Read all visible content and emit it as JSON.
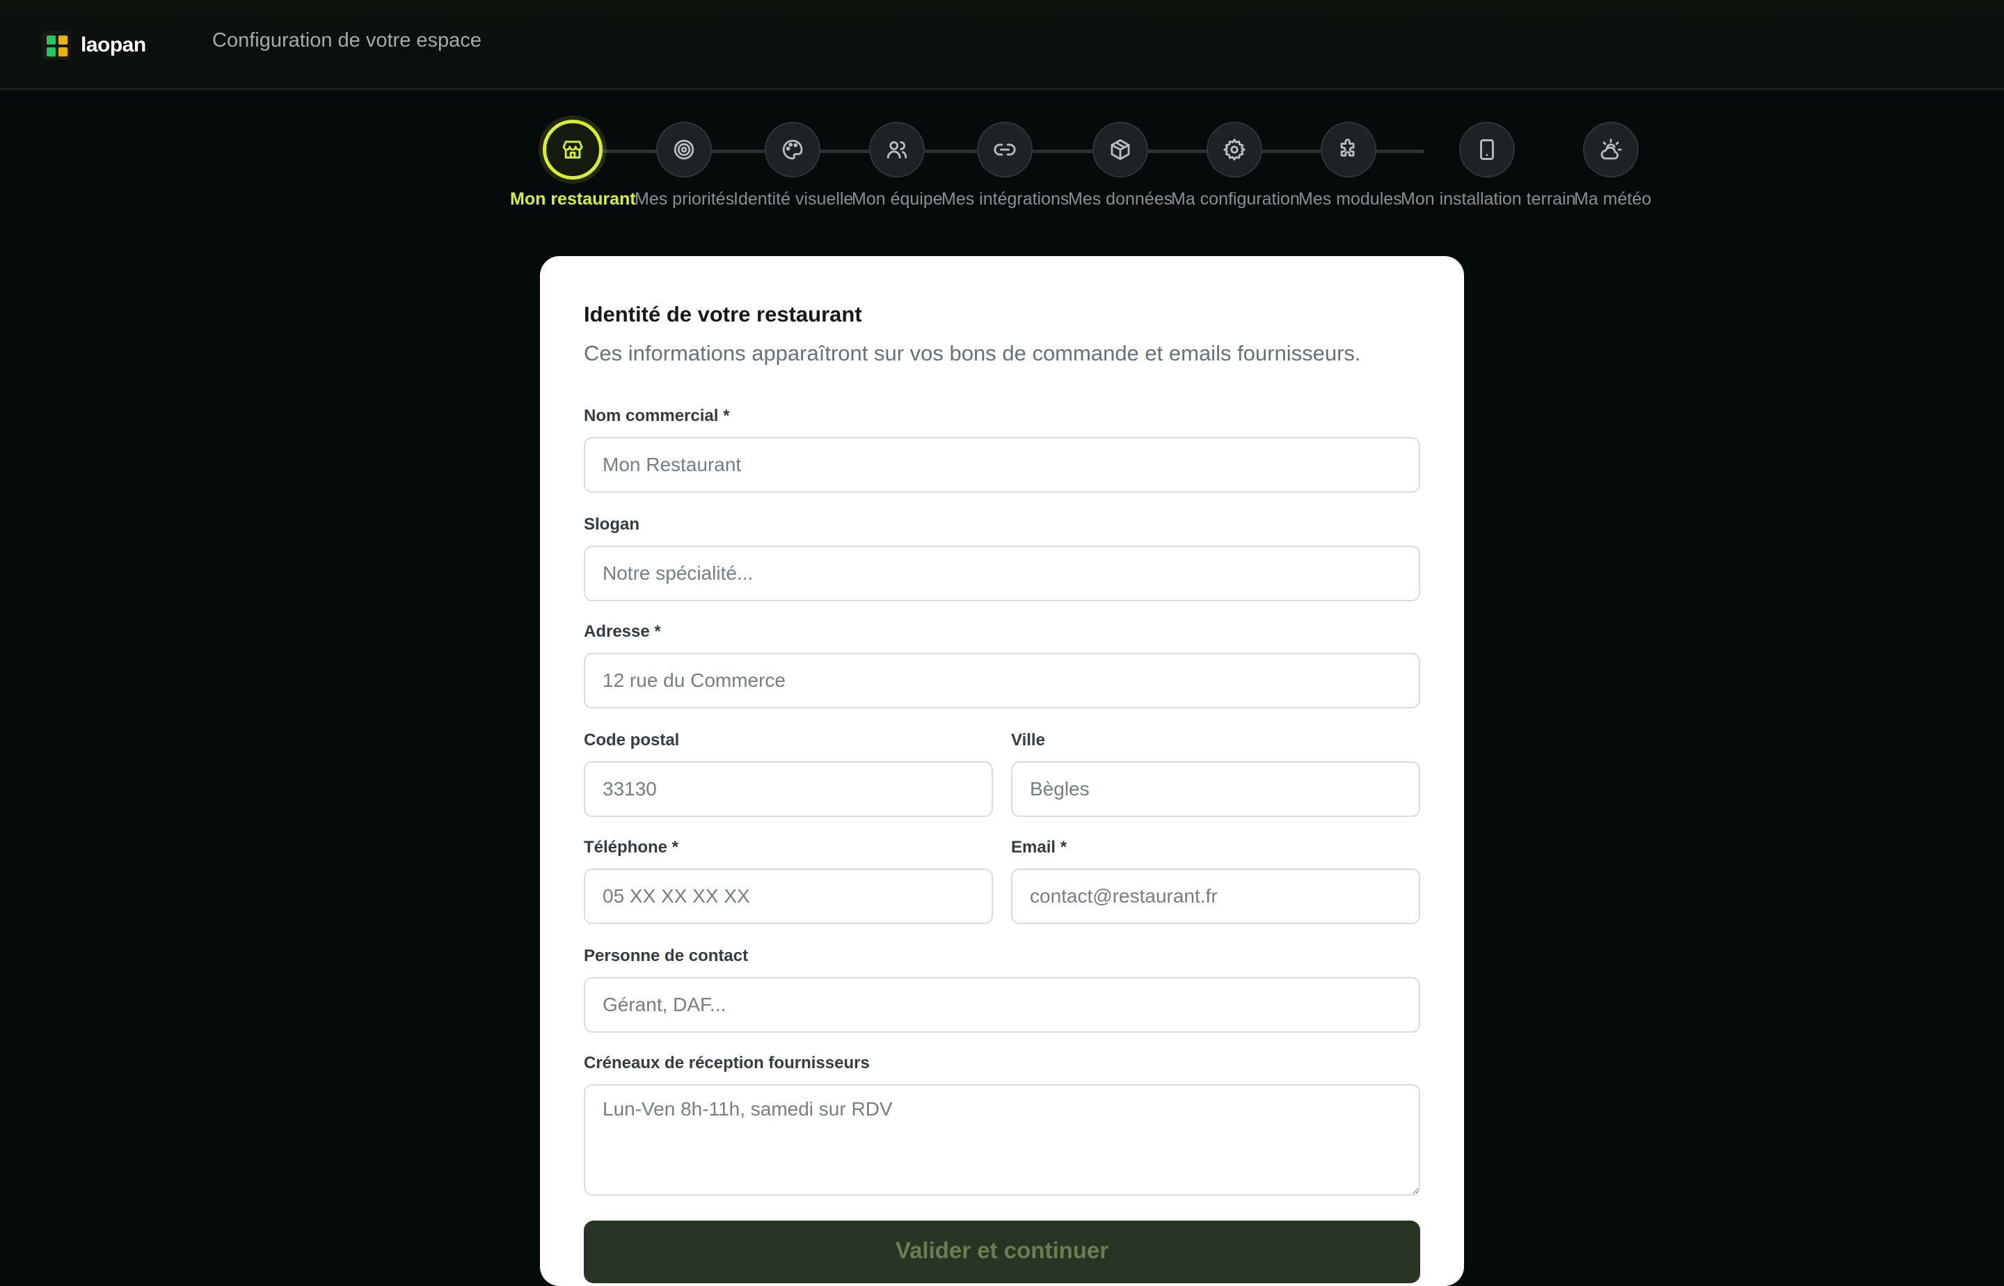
{
  "app": {
    "name": "laopan",
    "header_title": "Configuration de votre espace"
  },
  "colors": {
    "accent": "#d7f21f",
    "logo_green": "#22c55e",
    "logo_yellow": "#eab308"
  },
  "stepper": {
    "current": 0,
    "steps": [
      {
        "label": "Mon restaurant",
        "icon": "store-icon"
      },
      {
        "label": "Mes priorités",
        "icon": "target-icon"
      },
      {
        "label": "Identité visuelle",
        "icon": "palette-icon"
      },
      {
        "label": "Mon équipe",
        "icon": "users-icon"
      },
      {
        "label": "Mes intégrations",
        "icon": "link-icon"
      },
      {
        "label": "Mes données",
        "icon": "package-icon"
      },
      {
        "label": "Ma configuration",
        "icon": "gear-icon"
      },
      {
        "label": "Mes modules",
        "icon": "puzzle-icon"
      },
      {
        "label": "Mon installation terrain",
        "icon": "tablet-icon"
      },
      {
        "label": "Ma météo",
        "icon": "weather-icon"
      }
    ]
  },
  "form": {
    "title": "Identité de votre restaurant",
    "subtitle": "Ces informations apparaîtront sur vos bons de commande et emails fournisseurs.",
    "fields": {
      "nom_commercial": {
        "label": "Nom commercial *",
        "placeholder": "Mon Restaurant",
        "value": ""
      },
      "slogan": {
        "label": "Slogan",
        "placeholder": "Notre spécialité...",
        "value": ""
      },
      "adresse": {
        "label": "Adresse *",
        "placeholder": "12 rue du Commerce",
        "value": ""
      },
      "code_postal": {
        "label": "Code postal",
        "placeholder": "33130",
        "value": ""
      },
      "ville": {
        "label": "Ville",
        "placeholder": "Bègles",
        "value": ""
      },
      "telephone": {
        "label": "Téléphone *",
        "placeholder": "05 XX XX XX XX",
        "value": ""
      },
      "email": {
        "label": "Email *",
        "placeholder": "contact@restaurant.fr",
        "value": ""
      },
      "contact": {
        "label": "Personne de contact",
        "placeholder": "Gérant, DAF...",
        "value": ""
      },
      "creneaux": {
        "label": "Créneaux de réception fournisseurs",
        "placeholder": "Lun-Ven 8h-11h, samedi sur RDV",
        "value": ""
      }
    },
    "submit_label": "Valider et continuer"
  }
}
